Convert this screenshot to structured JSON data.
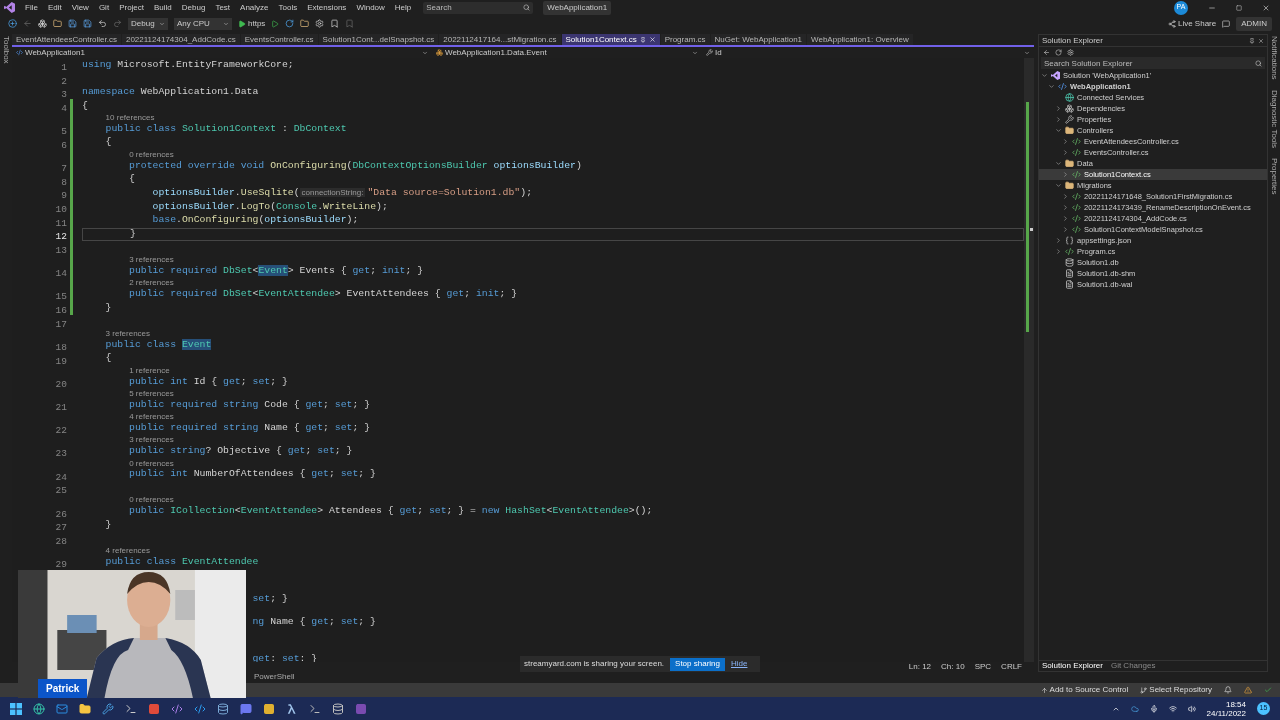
{
  "menu": [
    "File",
    "Edit",
    "View",
    "Git",
    "Project",
    "Build",
    "Debug",
    "Test",
    "Analyze",
    "Tools",
    "Extensions",
    "Window",
    "Help"
  ],
  "search": {
    "placeholder": "Search"
  },
  "solution_badge": "WebApplication1",
  "avatar": "PA",
  "toolbar": {
    "configuration": "Debug",
    "platform": "Any CPU",
    "run_target": "https",
    "live_share": "Live Share",
    "admin": "ADMIN"
  },
  "tabs": [
    {
      "label": "EventAttendeesController.cs",
      "selected": false
    },
    {
      "label": "20221124174304_AddCode.cs",
      "selected": false
    },
    {
      "label": "EventsController.cs",
      "selected": false
    },
    {
      "label": "Solution1Cont...delSnapshot.cs",
      "selected": false
    },
    {
      "label": "2022112417164...stMigration.cs",
      "selected": false
    },
    {
      "label": "Solution1Context.cs",
      "selected": true
    },
    {
      "label": "Program.cs",
      "selected": false
    },
    {
      "label": "NuGet: WebApplication1",
      "selected": false
    },
    {
      "label": "WebApplication1: Overview",
      "selected": false
    }
  ],
  "left_strip": "Toolbox",
  "right_strip": [
    "Notifications",
    "Diagnostic Tools",
    "Properties"
  ],
  "nav_bar": {
    "project": "WebApplication1",
    "type": "WebApplication1.Data.Event",
    "member": "Id"
  },
  "editor": {
    "lines": [
      {
        "kind": "line",
        "number": "1",
        "changed": false,
        "tokens": [
          {
            "text": "using",
            "kind": "kw"
          },
          {
            "text": " Microsoft.EntityFrameworkCore;",
            "kind": "plain"
          }
        ]
      },
      {
        "kind": "line",
        "number": "2",
        "changed": false
      },
      {
        "kind": "line",
        "number": "3",
        "changed": false,
        "tokens": [
          {
            "text": "namespace",
            "kind": "kw"
          },
          {
            "text": " WebApplication1.Data",
            "kind": "plain"
          }
        ]
      },
      {
        "kind": "line",
        "number": "4",
        "changed": true,
        "tokens": [
          {
            "text": "{",
            "kind": "plain"
          }
        ]
      },
      {
        "kind": "lens",
        "text": "10 references",
        "changed": true
      },
      {
        "kind": "line",
        "number": "5",
        "changed": true,
        "tokens": [
          {
            "text": "    public class ",
            "kind": "kw"
          },
          {
            "text": "Solution1Context",
            "kind": "type"
          },
          {
            "text": " : ",
            "kind": "plain"
          },
          {
            "text": "DbContext",
            "kind": "type"
          }
        ]
      },
      {
        "kind": "line",
        "number": "6",
        "changed": true,
        "tokens": [
          {
            "text": "    {",
            "kind": "plain"
          }
        ]
      },
      {
        "kind": "lens",
        "text": "0 references",
        "changed": true
      },
      {
        "kind": "line",
        "number": "7",
        "changed": true,
        "tokens": [
          {
            "text": "        protected override void ",
            "kind": "kw"
          },
          {
            "text": "OnConfiguring",
            "kind": "fn"
          },
          {
            "text": "(",
            "kind": "plain"
          },
          {
            "text": "DbContextOptionsBuilder",
            "kind": "type"
          },
          {
            "text": " optionsBuilder",
            "kind": "var"
          },
          {
            "text": ")",
            "kind": "plain"
          }
        ]
      },
      {
        "kind": "line",
        "number": "8",
        "changed": true,
        "tokens": [
          {
            "text": "        {",
            "kind": "plain"
          }
        ]
      },
      {
        "kind": "line",
        "number": "9",
        "changed": true,
        "tokens": [
          {
            "text": "            optionsBuilder",
            "kind": "var"
          },
          {
            "text": ".",
            "kind": "plain"
          },
          {
            "text": "UseSqlite",
            "kind": "fn"
          },
          {
            "text": "(",
            "kind": "plain"
          },
          {
            "text": "connectionString:",
            "kind": "hint"
          },
          {
            "text": "\"Data source=Solution1.db\"",
            "kind": "str"
          },
          {
            "text": ");",
            "kind": "plain"
          }
        ]
      },
      {
        "kind": "line",
        "number": "10",
        "changed": true,
        "tokens": [
          {
            "text": "            optionsBuilder",
            "kind": "var"
          },
          {
            "text": ".",
            "kind": "plain"
          },
          {
            "text": "LogTo",
            "kind": "fn"
          },
          {
            "text": "(",
            "kind": "plain"
          },
          {
            "text": "Console",
            "kind": "type"
          },
          {
            "text": ".",
            "kind": "plain"
          },
          {
            "text": "WriteLine",
            "kind": "fn"
          },
          {
            "text": ");",
            "kind": "plain"
          }
        ]
      },
      {
        "kind": "line",
        "number": "11",
        "changed": true,
        "tokens": [
          {
            "text": "            base",
            "kind": "kw"
          },
          {
            "text": ".",
            "kind": "plain"
          },
          {
            "text": "OnConfiguring",
            "kind": "fn"
          },
          {
            "text": "(",
            "kind": "plain"
          },
          {
            "text": "optionsBuilder",
            "kind": "var"
          },
          {
            "text": ");",
            "kind": "plain"
          }
        ]
      },
      {
        "kind": "line",
        "number": "12",
        "changed": true,
        "current": true,
        "tokens": [
          {
            "text": "        }",
            "kind": "plain"
          }
        ]
      },
      {
        "kind": "line",
        "number": "13",
        "changed": true
      },
      {
        "kind": "lens",
        "text": "3 references",
        "changed": true
      },
      {
        "kind": "line",
        "number": "14",
        "changed": true,
        "tokens": [
          {
            "text": "        public required ",
            "kind": "kw"
          },
          {
            "text": "DbSet",
            "kind": "type"
          },
          {
            "text": "<",
            "kind": "plain"
          },
          {
            "text": "Event",
            "kind": "hl"
          },
          {
            "text": "> Events { ",
            "kind": "plain"
          },
          {
            "text": "get",
            "kind": "kw"
          },
          {
            "text": "; ",
            "kind": "plain"
          },
          {
            "text": "init",
            "kind": "kw"
          },
          {
            "text": "; }",
            "kind": "plain"
          }
        ]
      },
      {
        "kind": "lens",
        "text": "2 references",
        "changed": true
      },
      {
        "kind": "line",
        "number": "15",
        "changed": true,
        "tokens": [
          {
            "text": "        public required ",
            "kind": "kw"
          },
          {
            "text": "DbSet",
            "kind": "type"
          },
          {
            "text": "<",
            "kind": "plain"
          },
          {
            "text": "EventAttendee",
            "kind": "type"
          },
          {
            "text": "> EventAttendees { ",
            "kind": "plain"
          },
          {
            "text": "get",
            "kind": "kw"
          },
          {
            "text": "; ",
            "kind": "plain"
          },
          {
            "text": "init",
            "kind": "kw"
          },
          {
            "text": "; }",
            "kind": "plain"
          }
        ]
      },
      {
        "kind": "line",
        "number": "16",
        "changed": true,
        "tokens": [
          {
            "text": "    }",
            "kind": "plain"
          }
        ]
      },
      {
        "kind": "line",
        "number": "17",
        "changed": false
      },
      {
        "kind": "lens",
        "text": "3 references",
        "changed": false
      },
      {
        "kind": "line",
        "number": "18",
        "changed": false,
        "tokens": [
          {
            "text": "    public class ",
            "kind": "kw"
          },
          {
            "text": "Event",
            "kind": "hl"
          }
        ]
      },
      {
        "kind": "line",
        "number": "19",
        "changed": false,
        "tokens": [
          {
            "text": "    {",
            "kind": "plain"
          }
        ]
      },
      {
        "kind": "lens",
        "text": "1 reference",
        "changed": false
      },
      {
        "kind": "line",
        "number": "20",
        "changed": false,
        "tokens": [
          {
            "text": "        public int ",
            "kind": "kw"
          },
          {
            "text": "Id { ",
            "kind": "plain"
          },
          {
            "text": "get",
            "kind": "kw"
          },
          {
            "text": "; ",
            "kind": "plain"
          },
          {
            "text": "set",
            "kind": "kw"
          },
          {
            "text": "; }",
            "kind": "plain"
          }
        ]
      },
      {
        "kind": "lens",
        "text": "5 references",
        "changed": false
      },
      {
        "kind": "line",
        "number": "21",
        "changed": false,
        "tokens": [
          {
            "text": "        public required string ",
            "kind": "kw"
          },
          {
            "text": "Code { ",
            "kind": "plain"
          },
          {
            "text": "get",
            "kind": "kw"
          },
          {
            "text": "; ",
            "kind": "plain"
          },
          {
            "text": "set",
            "kind": "kw"
          },
          {
            "text": "; }",
            "kind": "plain"
          }
        ]
      },
      {
        "kind": "lens",
        "text": "4 references",
        "changed": false
      },
      {
        "kind": "line",
        "number": "22",
        "changed": false,
        "tokens": [
          {
            "text": "        public required string ",
            "kind": "kw"
          },
          {
            "text": "Name { ",
            "kind": "plain"
          },
          {
            "text": "get",
            "kind": "kw"
          },
          {
            "text": "; ",
            "kind": "plain"
          },
          {
            "text": "set",
            "kind": "kw"
          },
          {
            "text": "; }",
            "kind": "plain"
          }
        ]
      },
      {
        "kind": "lens",
        "text": "3 references",
        "changed": false
      },
      {
        "kind": "line",
        "number": "23",
        "changed": false,
        "tokens": [
          {
            "text": "        public string",
            "kind": "kw"
          },
          {
            "text": "? Objective { ",
            "kind": "plain"
          },
          {
            "text": "get",
            "kind": "kw"
          },
          {
            "text": "; ",
            "kind": "plain"
          },
          {
            "text": "set",
            "kind": "kw"
          },
          {
            "text": "; }",
            "kind": "plain"
          }
        ]
      },
      {
        "kind": "lens",
        "text": "0 references",
        "changed": false
      },
      {
        "kind": "line",
        "number": "24",
        "changed": false,
        "tokens": [
          {
            "text": "        public int ",
            "kind": "kw"
          },
          {
            "text": "NumberOfAttendees { ",
            "kind": "plain"
          },
          {
            "text": "get",
            "kind": "kw"
          },
          {
            "text": "; ",
            "kind": "plain"
          },
          {
            "text": "set",
            "kind": "kw"
          },
          {
            "text": "; }",
            "kind": "plain"
          }
        ]
      },
      {
        "kind": "line",
        "number": "25",
        "changed": false
      },
      {
        "kind": "lens",
        "text": "0 references",
        "changed": false
      },
      {
        "kind": "line",
        "number": "26",
        "changed": false,
        "tokens": [
          {
            "text": "        public ",
            "kind": "kw"
          },
          {
            "text": "ICollection",
            "kind": "type"
          },
          {
            "text": "<",
            "kind": "plain"
          },
          {
            "text": "EventAttendee",
            "kind": "type"
          },
          {
            "text": "> Attendees { ",
            "kind": "plain"
          },
          {
            "text": "get",
            "kind": "kw"
          },
          {
            "text": "; ",
            "kind": "plain"
          },
          {
            "text": "set",
            "kind": "kw"
          },
          {
            "text": "; } = ",
            "kind": "plain"
          },
          {
            "text": "new ",
            "kind": "kw"
          },
          {
            "text": "HashSet",
            "kind": "type"
          },
          {
            "text": "<",
            "kind": "plain"
          },
          {
            "text": "EventAttendee",
            "kind": "type"
          },
          {
            "text": ">();",
            "kind": "plain"
          }
        ]
      },
      {
        "kind": "line",
        "number": "27",
        "changed": false,
        "tokens": [
          {
            "text": "    }",
            "kind": "plain"
          }
        ]
      },
      {
        "kind": "line",
        "number": "28",
        "changed": false
      },
      {
        "kind": "lens",
        "text": "4 references",
        "changed": false
      },
      {
        "kind": "line",
        "number": "29",
        "changed": false,
        "tokens": [
          {
            "text": "    public class ",
            "kind": "kw"
          },
          {
            "text": "EventAttendee",
            "kind": "type"
          }
        ]
      },
      {
        "kind": "line"
      },
      {
        "kind": "lens"
      },
      {
        "kind": "line",
        "tokens": [
          {
            "text": "                             set",
            "kind": "kw"
          },
          {
            "text": "; }",
            "kind": "plain"
          }
        ]
      },
      {
        "kind": "lens"
      },
      {
        "kind": "line",
        "tokens": [
          {
            "text": "                             ng ",
            "kind": "kw"
          },
          {
            "text": "Name { ",
            "kind": "plain"
          },
          {
            "text": "get",
            "kind": "kw"
          },
          {
            "text": "; ",
            "kind": "plain"
          },
          {
            "text": "set",
            "kind": "kw"
          },
          {
            "text": "; }",
            "kind": "plain"
          }
        ]
      },
      {
        "kind": "line"
      },
      {
        "kind": "lens"
      },
      {
        "kind": "line",
        "tokens": [
          {
            "text": "                             get",
            "kind": "kw"
          },
          {
            "text": ": ",
            "kind": "plain"
          },
          {
            "text": "set",
            "kind": "kw"
          },
          {
            "text": ": }",
            "kind": "plain"
          }
        ]
      }
    ]
  },
  "editor_status": [
    "Ln: 12",
    "Ch: 10",
    "SPC",
    "CRLF"
  ],
  "bottom_panel_tab": "PowerShell",
  "solution_explorer": {
    "title": "Solution Explorer",
    "search": {
      "placeholder": "Search Solution Explorer"
    },
    "tree": [
      {
        "label": "Solution 'WebApplication1'",
        "kind": "solution",
        "selected": false,
        "children": [
          {
            "label": "WebApplication1",
            "kind": "project",
            "expanded": true,
            "selected": false,
            "children": [
              {
                "label": "Connected Services",
                "kind": "service",
                "selected": false
              },
              {
                "label": "Dependencies",
                "kind": "deps",
                "expanded": false,
                "selected": false
              },
              {
                "label": "Properties",
                "kind": "props",
                "expanded": false,
                "selected": false
              },
              {
                "label": "Controllers",
                "kind": "folder",
                "expanded": true,
                "selected": false,
                "children": [
                  {
                    "label": "EventAttendeesController.cs",
                    "kind": "cs",
                    "expanded": false,
                    "selected": false
                  },
                  {
                    "label": "EventsController.cs",
                    "kind": "cs",
                    "expanded": false,
                    "selected": false
                  }
                ]
              },
              {
                "label": "Data",
                "kind": "folder",
                "expanded": true,
                "selected": false,
                "children": [
                  {
                    "label": "Solution1Context.cs",
                    "kind": "cs",
                    "expanded": false,
                    "selected": true
                  }
                ]
              },
              {
                "label": "Migrations",
                "kind": "folder",
                "expanded": true,
                "selected": false,
                "children": [
                  {
                    "label": "20221124171648_Solution1FirstMigration.cs",
                    "kind": "cs",
                    "expanded": false,
                    "selected": false
                  },
                  {
                    "label": "20221124173439_RenameDescriptionOnEvent.cs",
                    "kind": "cs",
                    "expanded": false,
                    "selected": false
                  },
                  {
                    "label": "20221124174304_AddCode.cs",
                    "kind": "cs",
                    "expanded": false,
                    "selected": false
                  },
                  {
                    "label": "Solution1ContextModelSnapshot.cs",
                    "kind": "cs",
                    "expanded": false,
                    "selected": false
                  }
                ]
              },
              {
                "label": "appsettings.json",
                "kind": "json",
                "expanded": false,
                "selected": false
              },
              {
                "label": "Program.cs",
                "kind": "cs",
                "expanded": false,
                "selected": false
              },
              {
                "label": "Solution1.db",
                "kind": "db",
                "selected": false
              },
              {
                "label": "Solution1.db-shm",
                "kind": "file",
                "selected": false
              },
              {
                "label": "Solution1.db-wal",
                "kind": "file",
                "selected": false
              }
            ]
          }
        ]
      }
    ],
    "bottom_tabs": [
      {
        "label": "Solution Explorer",
        "selected": true
      },
      {
        "label": "Git Changes",
        "selected": false
      }
    ]
  },
  "status_bar": {
    "source_control": "Add to Source Control",
    "repository": "Select Repository"
  },
  "sharing_notice": {
    "text": "streamyard.com is sharing your screen.",
    "stop": "Stop sharing",
    "hide": "Hide"
  },
  "webcam": {
    "kind": "picture",
    "name": "Patrick"
  },
  "taskbar": {
    "time": "18:54",
    "date": "24/11/2022",
    "notifications": "15"
  }
}
